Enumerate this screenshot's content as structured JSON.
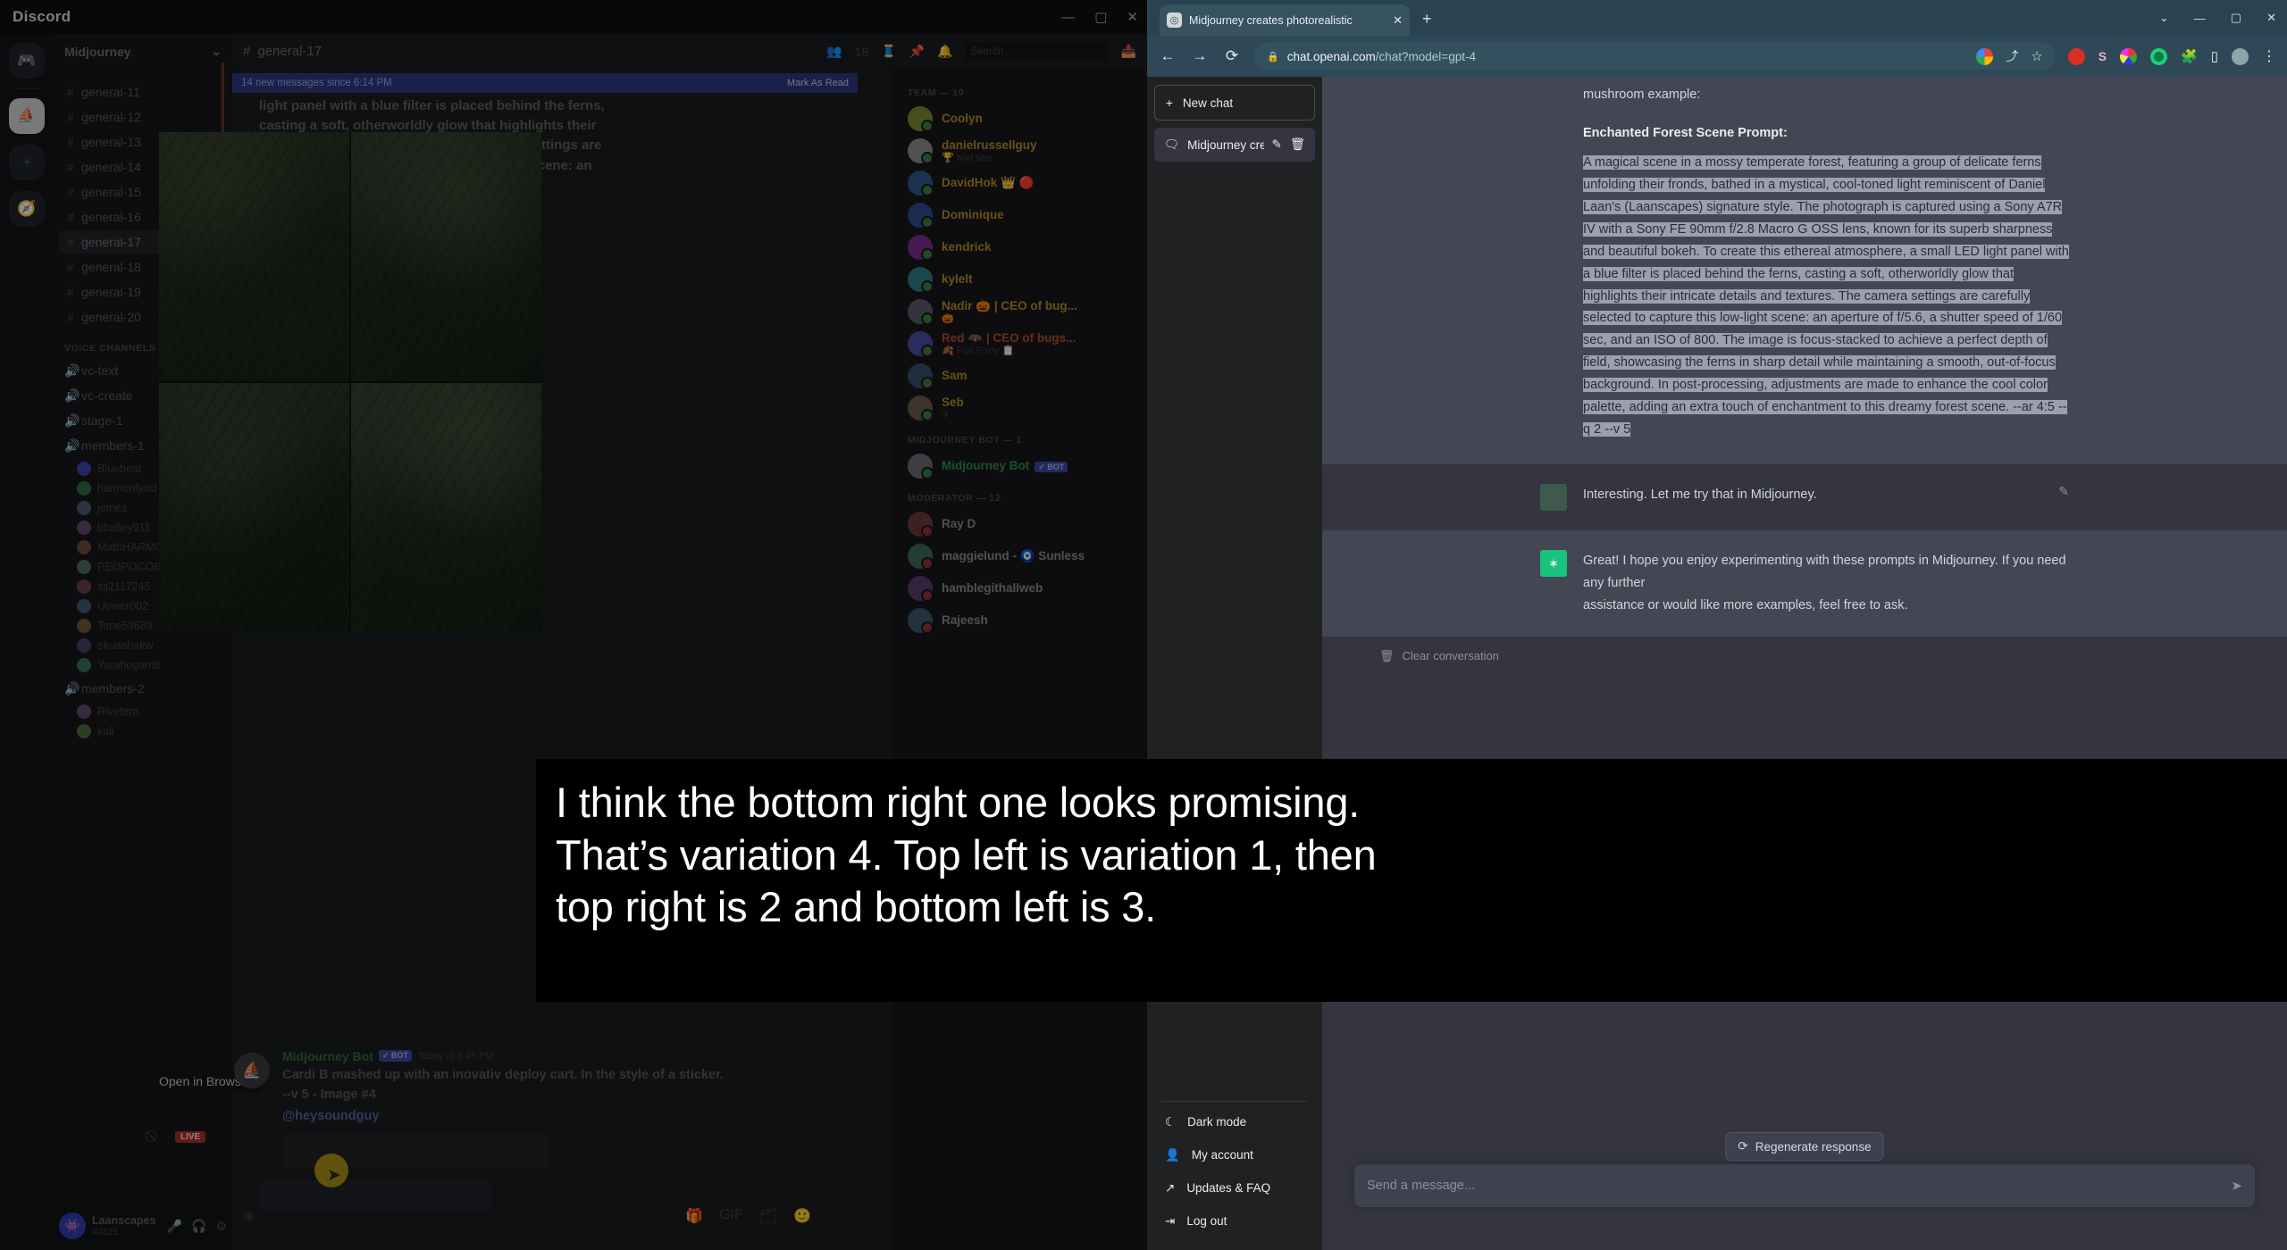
{
  "discord": {
    "window_title": "Discord",
    "window_controls": [
      "—",
      "▢",
      "✕"
    ],
    "guild_name": "Midjourney",
    "channels": [
      {
        "name": "general-11",
        "active": false
      },
      {
        "name": "general-12",
        "active": false
      },
      {
        "name": "general-13",
        "active": false
      },
      {
        "name": "general-14",
        "active": false
      },
      {
        "name": "general-15",
        "active": false
      },
      {
        "name": "general-16",
        "active": false
      },
      {
        "name": "general-17",
        "active": true
      },
      {
        "name": "general-18",
        "active": false
      },
      {
        "name": "general-19",
        "active": false
      },
      {
        "name": "general-20",
        "active": false
      }
    ],
    "voice_category": "VOICE CHANNELS",
    "voice_channels": [
      {
        "name": "vc-text"
      },
      {
        "name": "vc-create"
      },
      {
        "name": "stage-1"
      },
      {
        "name": "members-1"
      }
    ],
    "voice_members": [
      {
        "name": "Bluebeat",
        "color": "#3b42a8"
      },
      {
        "name": "harmonfjord",
        "color": "#2f6b3d"
      },
      {
        "name": "jemez",
        "color": "#4a5a6b"
      },
      {
        "name": "bballey911",
        "color": "#5b4a6b"
      },
      {
        "name": "MathHARMO",
        "color": "#6b4a3b"
      },
      {
        "name": "PEOPOCOER",
        "color": "#4a6b5b"
      },
      {
        "name": "sij2117245",
        "color": "#6b3b4a"
      },
      {
        "name": "Uower002",
        "color": "#3b5b6b"
      },
      {
        "name": "Tone53689",
        "color": "#6b5b3b"
      },
      {
        "name": "ekuashakw",
        "color": "#4a3b6b"
      },
      {
        "name": "Yarahogamit",
        "color": "#3b6b5b"
      }
    ],
    "members_category_2": "members-2",
    "voice_members_2": [
      {
        "name": "Rivetera",
        "color": "#5a4a6b"
      },
      {
        "name": "kali",
        "color": "#4a6b3b"
      }
    ],
    "live_badge": "LIVE",
    "user_panel": {
      "name": "Laanscapes",
      "tag": "#2425"
    },
    "channel_header": {
      "name": "general-17",
      "member_count": "18"
    },
    "search_placeholder": "Search",
    "new_messages_divider": "14 new messages since 6:14 PM",
    "mark_as_read": "Mark As Read",
    "top_message_text": "light panel with a blue filter is placed behind the ferns, casting a soft, otherworldly glow that highlights their intricate details and textures. The camera settings are carefully selected to capture this low-light scene: an",
    "tooltip": "Open in Browser",
    "bot_message": {
      "author": "Midjourney Bot",
      "badge": "✓ BOT",
      "timestamp": "Today at 6:45 PM",
      "content": "Cardi B mashed up with an inovativ deploy cart. In the style of a sticker. --v 5 - Image #4",
      "mention": "@heysoundguy"
    },
    "members_panel": {
      "team_header": "TEAM — 10",
      "team": [
        {
          "name": "Coolyn",
          "color": "#b58b2a",
          "av": "#7b8a2e"
        },
        {
          "name": "danielrussellguy",
          "sub": "🏆 and see",
          "color": "#b58b2a",
          "av": "#8a8a8a"
        },
        {
          "name": "DavidHok 👑 🔴",
          "color": "#b58b2a",
          "av": "#2e5a8a"
        },
        {
          "name": "Dominique",
          "color": "#b58b2a",
          "av": "#2e4a8a"
        },
        {
          "name": "kendrick",
          "color": "#b58b2a",
          "av": "#7a2e8a"
        },
        {
          "name": "kylelt",
          "color": "#b58b2a",
          "av": "#2e7a8a"
        },
        {
          "name": "Nadir 🎃 | CEO of bug...",
          "sub": "🎃",
          "color": "#b58b2a",
          "av": "#5a5a6a"
        },
        {
          "name": "Red 🦇 | CEO of bugs...",
          "sub": "🍂 Fun Party 📋",
          "color": "#b54a2a",
          "av": "#4a4aa0"
        },
        {
          "name": "Sam",
          "color": "#b58b2a",
          "av": "#3a4a6a"
        },
        {
          "name": "Seb",
          "sub": "✈",
          "color": "#b58b2a",
          "av": "#6a5a4a"
        }
      ],
      "bot_header": "MIDJOURNEY BOT — 1",
      "bots": [
        {
          "name": "Midjourney Bot",
          "badge": "✓ BOT",
          "color": "#2f8b4d",
          "av": "#6a6a72"
        }
      ],
      "moderator_header": "MODERATOR — 12",
      "moderators": [
        {
          "name": "Ray D",
          "color": "#8a8c92",
          "av": "#6a3a3a"
        },
        {
          "name": "maggielund - 🧿 Sunless",
          "color": "#8a8c92",
          "av": "#3a6a5a"
        },
        {
          "name": "hamblegithallweb",
          "color": "#8a8c92",
          "av": "#5a3a6a"
        },
        {
          "name": "Rajeesh",
          "color": "#8a8c92",
          "av": "#3a5a6a"
        }
      ]
    }
  },
  "chrome": {
    "tab_title": "Midjourney creates photorealistic",
    "tab_close": "✕",
    "new_tab": "+",
    "window_controls": [
      "⌄",
      "—",
      "▢",
      "✕"
    ],
    "back": "←",
    "forward": "→",
    "reload": "⟳",
    "lock_icon": "🔒",
    "url_domain": "chat.openai.com",
    "url_path": "/chat?model=gpt-4",
    "menu": "⋮"
  },
  "chatgpt": {
    "new_chat_label": "New chat",
    "new_chat_plus": "+",
    "conversation_title": "Midjourney creates pho",
    "conversation_edit_icon": "✎",
    "conversation_delete_icon": "🗑",
    "menu_items": [
      {
        "label": "Dark mode",
        "icon": "moon-icon",
        "glyph": "☾"
      },
      {
        "label": "My account",
        "icon": "person-icon",
        "glyph": "👤"
      },
      {
        "label": "Updates & FAQ",
        "icon": "external-link-icon",
        "glyph": "↗"
      },
      {
        "label": "Log out",
        "icon": "logout-icon",
        "glyph": "⇥"
      }
    ],
    "thread": {
      "intro_tail": "mushroom example:",
      "prompt_heading": "Enchanted Forest Scene Prompt:",
      "prompt_body": "A magical scene in a mossy temperate forest, featuring a group of delicate ferns unfolding their fronds, bathed in a mystical, cool-toned light reminiscent of Daniel Laan's (Laanscapes) signature style. The photograph is captured using a Sony A7R IV with a Sony FE 90mm f/2.8 Macro G OSS lens, known for its superb sharpness and beautiful bokeh. To create this ethereal atmosphere, a small LED light panel with a blue filter is placed behind the ferns, casting a soft, otherworldly glow that highlights their intricate details and textures. The camera settings are carefully selected to capture this low-light scene: an aperture of f/5.6, a shutter speed of 1/60 sec, and an ISO of 800. The image is focus-stacked to achieve a perfect depth of field, showcasing the ferns in sharp detail while maintaining a smooth, out-of-focus background. In post-processing, adjustments are made to enhance the cool color palette, adding an extra touch of enchantment to this dreamy forest scene. --ar 4:5 --q 2 --v 5",
      "user_reply": "Interesting. Let me try that in Midjourney.",
      "assistant_tail_1": "Great! I hope you enjoy experimenting with these prompts in Midjourney. If you need any further",
      "assistant_tail_2": "assistance or would like more examples, feel free to ask.",
      "clear_conversation": "Clear conversation"
    },
    "regenerate_label": "Regenerate response",
    "regenerate_icon": "⟳",
    "composer_placeholder": "Send a message...",
    "send_icon": "➤"
  },
  "subtitle": {
    "line1": "I think the bottom right one looks promising.",
    "line2": "That’s variation 4. Top left is variation 1, then",
    "line3": "top right is 2 and bottom left is 3."
  },
  "colors": {
    "discord_bg": "#1e1f22",
    "chrome_teal": "#2f4858",
    "gpt_bg": "#343541",
    "gpt_assistant_bg": "#444654",
    "accent_green": "#19c37d",
    "selection": "#9aa0ad"
  }
}
